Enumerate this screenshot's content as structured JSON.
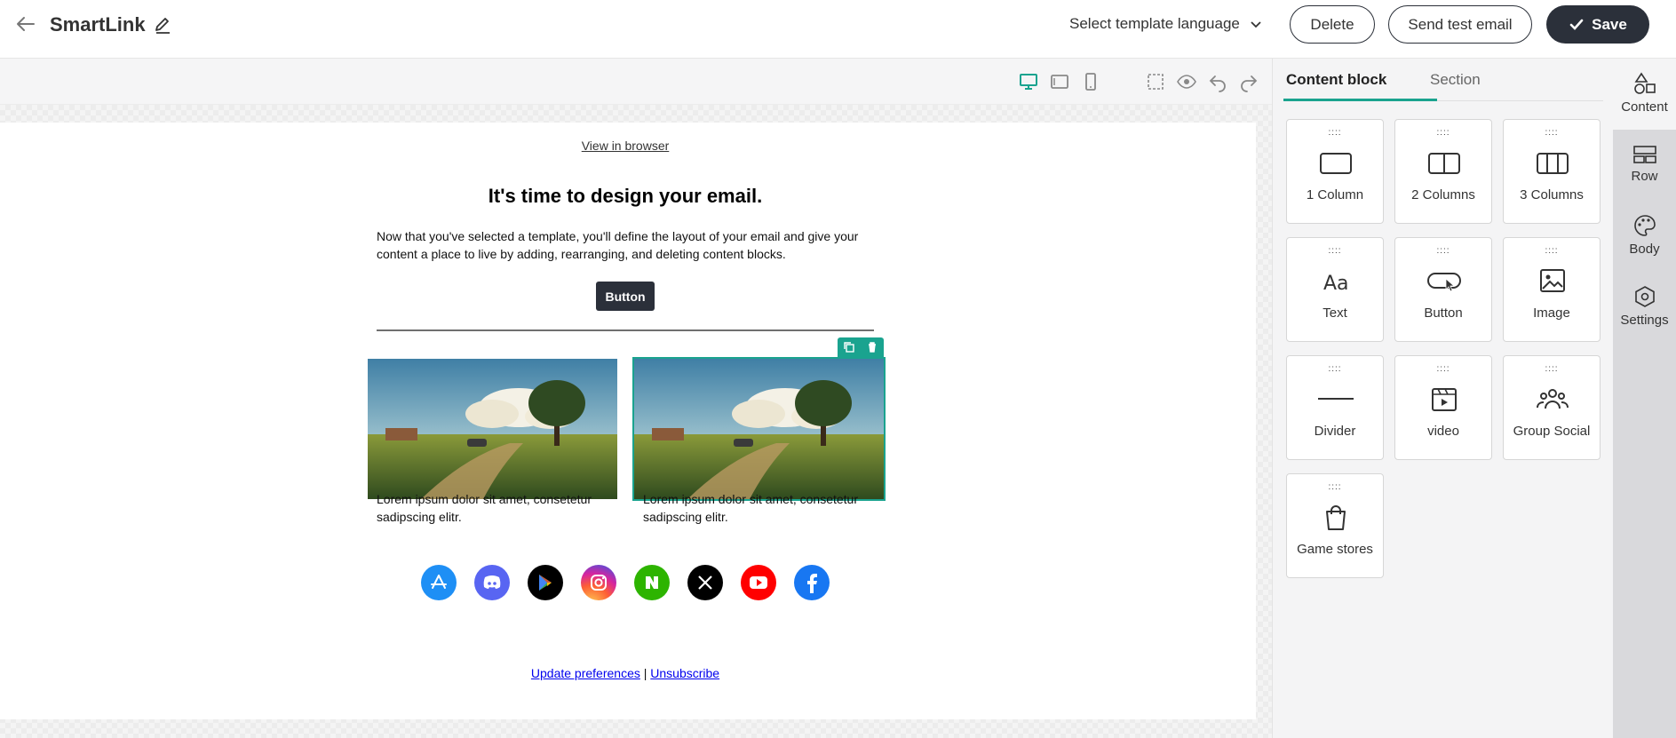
{
  "header": {
    "title": "SmartLink",
    "language_selector": "Select template language",
    "delete_label": "Delete",
    "send_test_label": "Send test email",
    "save_label": "Save"
  },
  "toolbar": {
    "icons": [
      "desktop-icon",
      "tablet-icon",
      "mobile-icon",
      "select-area-icon",
      "preview-eye-icon",
      "undo-icon",
      "redo-icon"
    ]
  },
  "email": {
    "view_in_browser": "View in browser",
    "headline": "It's time to design your email.",
    "paragraph": "Now that you've selected a template, you'll define the layout of your email and give your content a place to live by adding, rearranging, and deleting content blocks.",
    "button_label": "Button",
    "caption_left": "Lorem ipsum dolor sit amet, consetetur sadipscing elitr.",
    "caption_right": "Lorem ipsum dolor sit amet, consetetur sadipscing elitr.",
    "social_icons": [
      "app-store-icon",
      "discord-icon",
      "google-play-icon",
      "instagram-icon",
      "naver-icon",
      "x-icon",
      "youtube-icon",
      "facebook-icon"
    ],
    "footer_update": "Update preferences",
    "footer_separator": "|",
    "footer_unsubscribe": "Unsubscribe"
  },
  "panel": {
    "tabs": [
      {
        "label": "Content block",
        "active": true
      },
      {
        "label": "Section",
        "active": false
      }
    ],
    "blocks": [
      {
        "label": "1 Column",
        "icon": "one-column-icon"
      },
      {
        "label": "2 Columns",
        "icon": "two-columns-icon"
      },
      {
        "label": "3 Columns",
        "icon": "three-columns-icon"
      },
      {
        "label": "Text",
        "icon": "text-icon"
      },
      {
        "label": "Button",
        "icon": "button-icon"
      },
      {
        "label": "Image",
        "icon": "image-icon"
      },
      {
        "label": "Divider",
        "icon": "divider-icon"
      },
      {
        "label": "video",
        "icon": "video-icon"
      },
      {
        "label": "Group Social",
        "icon": "group-social-icon"
      },
      {
        "label": "Game stores",
        "icon": "game-stores-icon"
      }
    ]
  },
  "rail": {
    "items": [
      {
        "label": "Content",
        "icon": "shapes-icon",
        "active": true
      },
      {
        "label": "Row",
        "icon": "row-icon",
        "active": false
      },
      {
        "label": "Body",
        "icon": "palette-icon",
        "active": false
      },
      {
        "label": "Settings",
        "icon": "settings-hex-icon",
        "active": false
      }
    ]
  },
  "colors": {
    "accent": "#1aa38f",
    "dark": "#2b303a"
  }
}
